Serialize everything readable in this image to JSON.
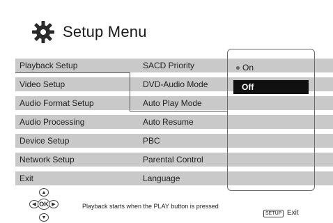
{
  "header": {
    "title": "Setup Menu",
    "icon": "gear-icon"
  },
  "left_menu": [
    "Playback Setup",
    "Video Setup",
    "Audio Format Setup",
    "Audio Processing",
    "Device Setup",
    "Network Setup",
    "Exit"
  ],
  "sub_menu": [
    "SACD Priority",
    "DVD-Audio Mode",
    "Auto Play Mode",
    "Auto Resume",
    "PBC",
    "Parental Control",
    "Language"
  ],
  "popup": {
    "options": [
      {
        "label": "On",
        "selected": false
      },
      {
        "label": "Off",
        "selected": true
      }
    ]
  },
  "footer": {
    "ok_label": "OK",
    "hint": "Playback starts when the PLAY button is pressed",
    "setup_key": "SETUP",
    "exit_label": "Exit"
  },
  "colors": {
    "row_bg": "#c9c9c9",
    "highlight_bg": "#101010",
    "highlight_text": "#ffffff"
  }
}
